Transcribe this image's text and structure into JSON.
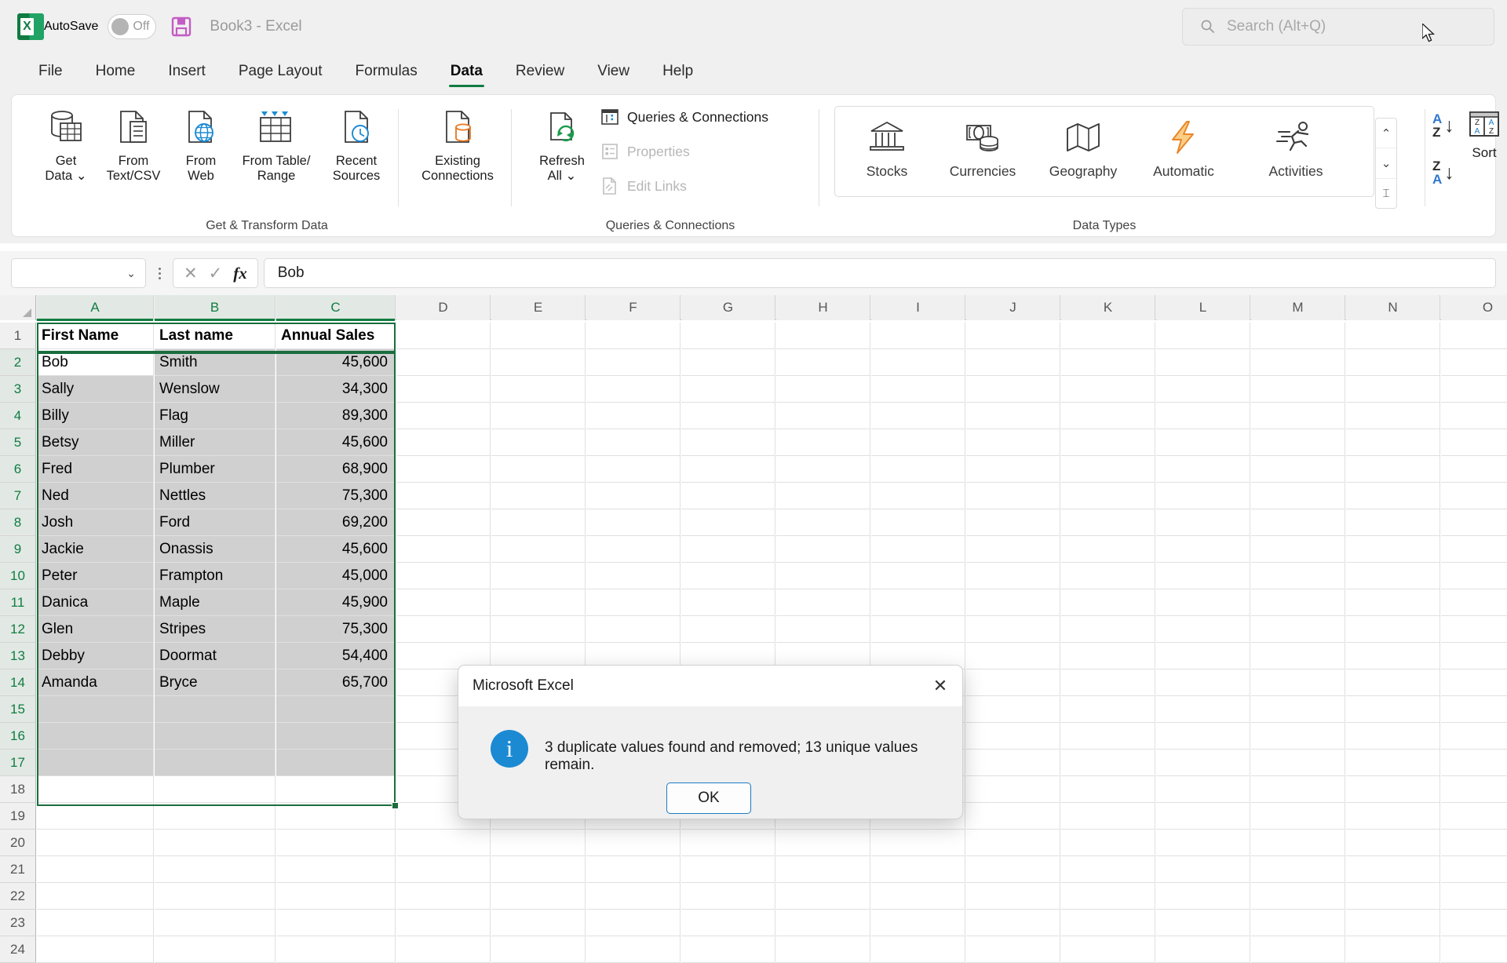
{
  "titlebar": {
    "autosave_label": "AutoSave",
    "autosave_state": "Off",
    "document_title": "Book3  -  Excel",
    "search_placeholder": "Search (Alt+Q)"
  },
  "tabs": [
    {
      "label": "File",
      "active": false
    },
    {
      "label": "Home",
      "active": false
    },
    {
      "label": "Insert",
      "active": false
    },
    {
      "label": "Page Layout",
      "active": false
    },
    {
      "label": "Formulas",
      "active": false
    },
    {
      "label": "Data",
      "active": true
    },
    {
      "label": "Review",
      "active": false
    },
    {
      "label": "View",
      "active": false
    },
    {
      "label": "Help",
      "active": false
    }
  ],
  "ribbon": {
    "groups": [
      {
        "name": "Get & Transform Data",
        "label": "Get & Transform Data"
      },
      {
        "name": "Queries & Connections",
        "label": "Queries & Connections"
      },
      {
        "name": "Data Types",
        "label": "Data Types"
      }
    ],
    "get_transform": [
      {
        "label": "Get\nData ⌄",
        "icon": "get-data-icon"
      },
      {
        "label": "From\nText/CSV",
        "icon": "from-text-csv-icon"
      },
      {
        "label": "From\nWeb",
        "icon": "from-web-icon"
      },
      {
        "label": "From Table/\nRange",
        "icon": "from-table-range-icon"
      },
      {
        "label": "Recent\nSources",
        "icon": "recent-sources-icon"
      },
      {
        "label": "Existing\nConnections",
        "icon": "existing-connections-icon"
      }
    ],
    "queries": {
      "refresh_label": "Refresh\nAll ⌄",
      "items": [
        {
          "label": "Queries & Connections",
          "disabled": false,
          "icon": "queries-connections-icon"
        },
        {
          "label": "Properties",
          "disabled": true,
          "icon": "properties-icon"
        },
        {
          "label": "Edit Links",
          "disabled": true,
          "icon": "edit-links-icon"
        }
      ]
    },
    "data_types": [
      {
        "label": "Stocks",
        "icon": "stocks-icon"
      },
      {
        "label": "Currencies",
        "icon": "currencies-icon"
      },
      {
        "label": "Geography",
        "icon": "geography-icon"
      },
      {
        "label": "Automatic",
        "icon": "automatic-lightning-icon"
      },
      {
        "label": "Activities",
        "icon": "activities-runner-icon"
      }
    ],
    "sort": {
      "label": "Sort",
      "asc_label": "A Z",
      "desc_label": "Z A"
    }
  },
  "formula_bar": {
    "name_box_value": "",
    "cancel_icon": "cancel-icon",
    "enter_icon": "enter-icon",
    "function_icon": "insert-function-icon",
    "formula_value": "Bob"
  },
  "grid": {
    "columns": [
      "A",
      "B",
      "C",
      "D",
      "E",
      "F",
      "G",
      "H",
      "I",
      "J",
      "K",
      "L",
      "M",
      "N",
      "O"
    ],
    "selected_columns": [
      "A",
      "B",
      "C"
    ],
    "rows": [
      1,
      2,
      3,
      4,
      5,
      6,
      7,
      8,
      9,
      10,
      11,
      12,
      13,
      14,
      15,
      16,
      17,
      18,
      19,
      20,
      21,
      22,
      23,
      24
    ],
    "selected_rows": [
      2,
      3,
      4,
      5,
      6,
      7,
      8,
      9,
      10,
      11,
      12,
      13,
      14,
      15,
      16,
      17
    ],
    "headers": [
      "First Name",
      "Last name",
      "Annual Sales"
    ],
    "data": [
      [
        "Bob",
        "Smith",
        "45,600"
      ],
      [
        "Sally",
        "Wenslow",
        "34,300"
      ],
      [
        "Billy",
        "Flag",
        "89,300"
      ],
      [
        "Betsy",
        "Miller",
        "45,600"
      ],
      [
        "Fred",
        "Plumber",
        "68,900"
      ],
      [
        "Ned",
        "Nettles",
        "75,300"
      ],
      [
        "Josh",
        "Ford",
        "69,200"
      ],
      [
        "Jackie",
        "Onassis",
        "45,600"
      ],
      [
        "Peter",
        "Frampton",
        "45,000"
      ],
      [
        "Danica",
        "Maple",
        "45,900"
      ],
      [
        "Glen",
        "Stripes",
        "75,300"
      ],
      [
        "Debby",
        "Doormat",
        "54,400"
      ],
      [
        "Amanda",
        "Bryce",
        "65,700"
      ]
    ],
    "active_cell": "A2"
  },
  "dialog": {
    "title": "Microsoft Excel",
    "close_icon": "close-icon",
    "info_icon": "information-icon",
    "message": "3 duplicate values found and removed; 13 unique values remain.",
    "ok_label": "OK"
  },
  "colors": {
    "excel_green": "#107c41",
    "selection_green": "#1a6e3e",
    "info_blue": "#1b8ad3",
    "accent_orange": "#e8962f"
  }
}
